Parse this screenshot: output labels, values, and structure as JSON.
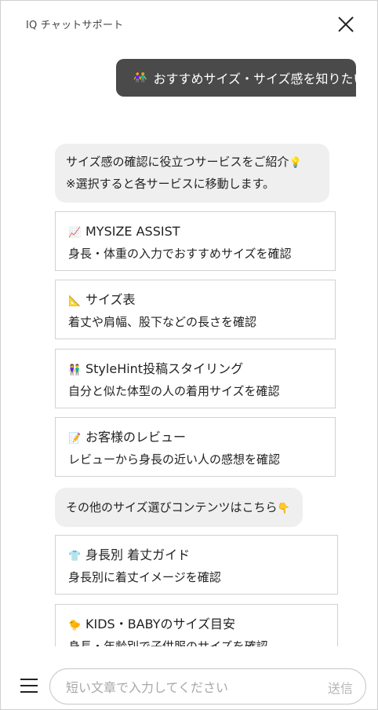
{
  "header": {
    "title": "IQ チャットサポート"
  },
  "user_message": {
    "icon": "👫",
    "text": "おすすめサイズ・サイズ感を知りたい"
  },
  "bot_message_1": {
    "line1": "サイズ感の確認に役立つサービスをご紹介",
    "line1_icon": "💡",
    "line2": "※選択すると各サービスに移動します。"
  },
  "options_1": [
    {
      "icon": "📈",
      "title": "MYSIZE ASSIST",
      "desc": "身長・体重の入力でおすすめサイズを確認"
    },
    {
      "icon": "📐",
      "title": "サイズ表",
      "desc": "着丈や肩幅、股下などの長さを確認"
    },
    {
      "icon": "👫",
      "title": "StyleHint投稿スタイリング",
      "desc": "自分と似た体型の人の着用サイズを確認"
    },
    {
      "icon": "📝",
      "title": "お客様のレビュー",
      "desc": "レビューから身長の近い人の感想を確認"
    }
  ],
  "bot_message_2": {
    "text": "その他のサイズ選びコンテンツはこちら",
    "icon": "👇"
  },
  "options_2": [
    {
      "icon": "👕",
      "title": "身長別 着丈ガイド",
      "desc": "身長別に着丈イメージを確認"
    },
    {
      "icon": "🐤",
      "title": "KIDS・BABYのサイズ目安",
      "desc": "身長・年齢別で子供服のサイズを確認"
    }
  ],
  "footer": {
    "input_placeholder": "短い文章で入力してください",
    "send_label": "送信"
  }
}
